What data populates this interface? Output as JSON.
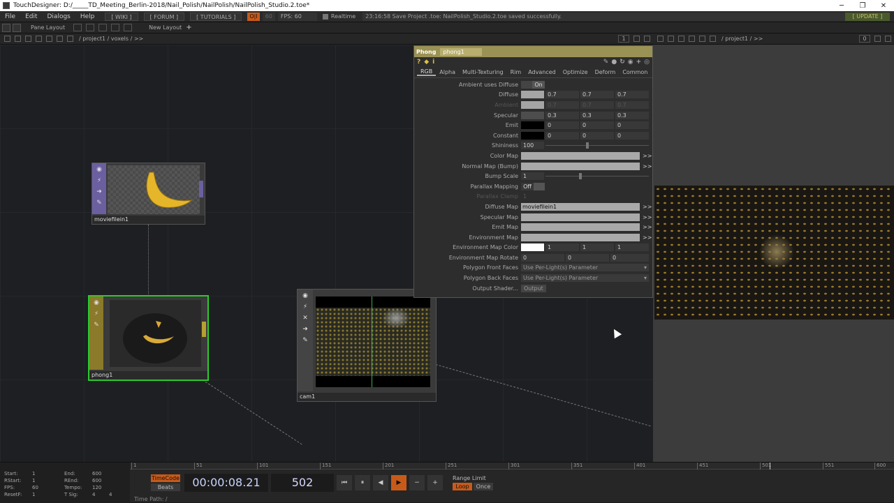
{
  "window": {
    "title": "TouchDesigner: D:/_____TD_Meeting_Berlin-2018/Nail_Polish/NailPolish/NailPolish_Studio.2.toe*",
    "minimize": "─",
    "maximize": "❐",
    "close": "✕"
  },
  "menu": {
    "items": [
      "File",
      "Edit",
      "Dialogs",
      "Help"
    ],
    "wiki": "[ WIKI ]",
    "forum": "[ FORUM ]",
    "tutorials": "[ TUTORIALS ]",
    "oi": "O|I",
    "fps_target": "60",
    "fps": "FPS:  60",
    "realtime": "Realtime",
    "status": "23:16:58 Save Project .toe: NailPolish_Studio.2.toe saved successfully.",
    "update": "[ UPDATE ]"
  },
  "toolbar": {
    "pane_layout": "Pane Layout",
    "new_layout": "New Layout",
    "plus": "+"
  },
  "left_pane": {
    "path": "/ project1 / voxels / >>"
  },
  "right_pane": {
    "page": "1",
    "path": "/ project1 / >>",
    "page_right": "0"
  },
  "nodes": {
    "moviefilein": "moviefilein1",
    "phong": "phong1",
    "cam": "cam1"
  },
  "param": {
    "type": "Phong",
    "name": "phong1",
    "tabs": [
      "RGB",
      "Alpha",
      "Multi-Texturing",
      "Rim",
      "Advanced",
      "Optimize",
      "Deform",
      "Common"
    ],
    "ambient_uses_diffuse": {
      "label": "Ambient uses Diffuse",
      "value": "On"
    },
    "diffuse": {
      "label": "Diffuse",
      "v": [
        "0.7",
        "0.7",
        "0.7"
      ]
    },
    "ambient": {
      "label": "Ambient",
      "v": [
        "0.7",
        "0.7",
        "0.7"
      ]
    },
    "specular": {
      "label": "Specular",
      "v": [
        "0.3",
        "0.3",
        "0.3"
      ]
    },
    "emit": {
      "label": "Emit",
      "v": [
        "0",
        "0",
        "0"
      ]
    },
    "constant": {
      "label": "Constant",
      "v": [
        "0",
        "0",
        "0"
      ]
    },
    "shininess": {
      "label": "Shininess",
      "value": "100",
      "slider": 0.4
    },
    "color_map": {
      "label": "Color Map",
      "value": ""
    },
    "normal_map": {
      "label": "Normal Map (Bump)",
      "value": ""
    },
    "bump_scale": {
      "label": "Bump Scale",
      "value": "1",
      "slider": 0.33
    },
    "parallax_mapping": {
      "label": "Parallax Mapping",
      "value": "Off"
    },
    "parallax_clamp": {
      "label": "Parallax Clamp",
      "value": "1"
    },
    "diffuse_map": {
      "label": "Diffuse Map",
      "value": "moviefilein1"
    },
    "specular_map": {
      "label": "Specular Map",
      "value": ""
    },
    "emit_map": {
      "label": "Emit Map",
      "value": ""
    },
    "environment_map": {
      "label": "Environment Map",
      "value": ""
    },
    "env_map_color": {
      "label": "Environment Map Color",
      "v": [
        "1",
        "1",
        "1"
      ]
    },
    "env_map_rotate": {
      "label": "Environment Map Rotate",
      "v": [
        "0",
        "0",
        "0"
      ]
    },
    "polygon_front_faces": {
      "label": "Polygon Front Faces",
      "value": "Use Per-Light(s) Parameter"
    },
    "polygon_back_faces": {
      "label": "Polygon Back Faces",
      "value": "Use Per-Light(s) Parameter"
    },
    "output_shader": {
      "label": "Output Shader...",
      "value": "Output"
    },
    "arrow": ">>"
  },
  "timeline": {
    "start_label": "Start:",
    "start": "1",
    "end_label": "End:",
    "end": "600",
    "rstart_label": "RStart:",
    "rstart": "1",
    "rend_label": "REnd:",
    "rend": "600",
    "fps_label": "FPS:",
    "fps": "60",
    "tempo_label": "Tempo:",
    "tempo": "120",
    "resetf_label": "ResetF:",
    "resetf": "1",
    "tsig_label": "T Sig:",
    "tsig_a": "4",
    "tsig_b": "4",
    "ticks": [
      "1",
      "51",
      "101",
      "151",
      "201",
      "251",
      "301",
      "351",
      "401",
      "451",
      "501",
      "551",
      "600"
    ],
    "timecode": "TimeCode",
    "beats": "Beats",
    "time": "00:00:08.21",
    "frame": "502",
    "range_limit": "Range Limit",
    "loop": "Loop",
    "once": "Once",
    "time_path": "Time Path: /"
  }
}
